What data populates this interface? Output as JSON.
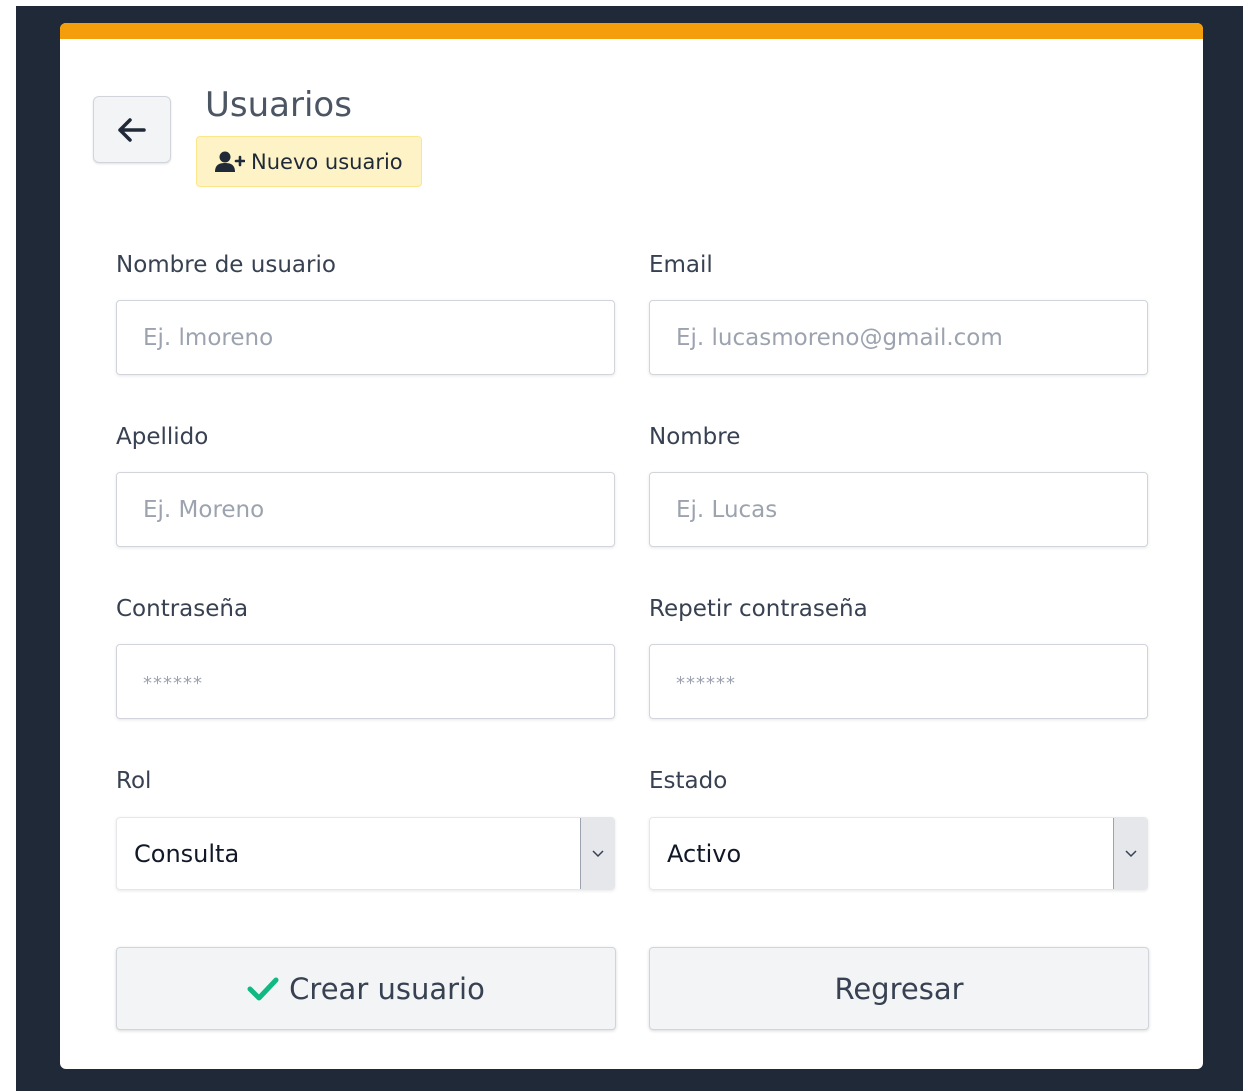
{
  "header": {
    "title": "Usuarios",
    "badge_label": "Nuevo usuario"
  },
  "form": {
    "username": {
      "label": "Nombre de usuario",
      "placeholder": "Ej. lmoreno"
    },
    "email": {
      "label": "Email",
      "placeholder": "Ej. lucasmoreno@gmail.com"
    },
    "lastname": {
      "label": "Apellido",
      "placeholder": "Ej. Moreno"
    },
    "firstname": {
      "label": "Nombre",
      "placeholder": "Ej. Lucas"
    },
    "password": {
      "label": "Contraseña",
      "placeholder": "******"
    },
    "password_repeat": {
      "label": "Repetir contraseña",
      "placeholder": "******"
    },
    "role": {
      "label": "Rol",
      "value": "Consulta"
    },
    "status": {
      "label": "Estado",
      "value": "Activo"
    }
  },
  "actions": {
    "create_label": "Crear usuario",
    "back_label": "Regresar"
  },
  "colors": {
    "accent": "#f59e0b",
    "badge_bg": "#fef3c7",
    "success": "#10b981",
    "frame": "#1f2937"
  },
  "icons": {
    "back": "arrow-left-icon",
    "badge": "user-plus-icon",
    "create": "check-icon",
    "dropdown": "chevron-down-icon"
  }
}
